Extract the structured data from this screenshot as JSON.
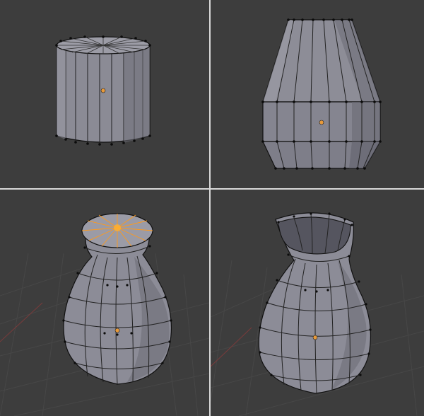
{
  "workspace": {
    "background_color": "#3d3d3d",
    "grid_color": "#474747",
    "separator_color": "#d8d8d8",
    "mesh_face_color": "#8b8b95",
    "mesh_edge_color": "#111111",
    "vertex_color": "#0b0b0b",
    "origin_color": "#e89a3a",
    "selected_color": "#ff9a1a"
  },
  "viewports": [
    {
      "id": "top-left",
      "step": 1,
      "object": "cylinder",
      "view": "perspective"
    },
    {
      "id": "top-right",
      "step": 2,
      "object": "tapered-cylinder",
      "view": "front"
    },
    {
      "id": "bottom-left",
      "step": 3,
      "object": "vase-with-selected-top-cap",
      "view": "perspective"
    },
    {
      "id": "bottom-right",
      "step": 4,
      "object": "open-vase",
      "view": "perspective"
    }
  ]
}
